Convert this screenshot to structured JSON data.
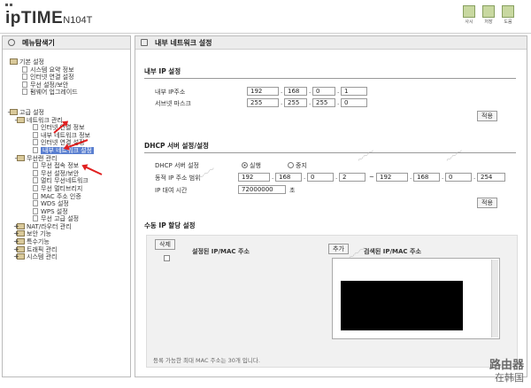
{
  "header": {
    "logo_main": "ipTIME",
    "logo_model": "N104T",
    "icons": [
      {
        "name": "help-icon",
        "label": "도움"
      },
      {
        "name": "save-icon",
        "label": "저장"
      },
      {
        "name": "info-icon",
        "label": "사시"
      }
    ]
  },
  "nav": {
    "title": "메뉴탐색기",
    "basic_setup": "기본 설정",
    "basic_items": [
      "시스템 요약 정보",
      "인터넷 연결 설정",
      "무선 설정/보안",
      "펌웨어 업그레이드"
    ],
    "advanced": "고급 설정",
    "network": "네트워크 관리",
    "network_items": [
      "인터넷 연결 정보",
      "내부 네트워크 정보",
      "인터넷 연결 설정",
      "내부 네트워크 설정"
    ],
    "wireless": "무선랜 관리",
    "wireless_items": [
      "무선 접속 정보",
      "무선 설정/보안",
      "멀티 무선네트워크",
      "무선 멀티브리지",
      "MAC 주소 인증",
      "WDS 설정",
      "WPS 설정",
      "무선 고급 설정"
    ],
    "other_groups": [
      "NAT/라우터 관리",
      "보안 기능",
      "특수기능",
      "트래픽 관리",
      "시스템 관리"
    ]
  },
  "content": {
    "panel_title": "내부 네트워크 설정",
    "ip_section": {
      "title": "내부 IP 설정",
      "ip_label": "내부 IP주소",
      "ip": [
        "192",
        "168",
        "0",
        "1"
      ],
      "mask_label": "서브넷 마스크",
      "mask": [
        "255",
        "255",
        "255",
        "0"
      ],
      "apply": "적용"
    },
    "dhcp_section": {
      "title": "DHCP 서버 설정/설정",
      "server_label": "DHCP 서버 설정",
      "opt_on": "실행",
      "opt_off": "중지",
      "range_label": "동적 IP 주소 범위",
      "range_start": [
        "192",
        "168",
        "0",
        "2"
      ],
      "range_end": [
        "192",
        "168",
        "0",
        "254"
      ],
      "tilde": "~",
      "lease_label": "IP 대여 시간",
      "lease_value": "72000000",
      "lease_unit": "초",
      "apply": "적용"
    },
    "manual_section": {
      "title": "수동 IP 할당 설정",
      "delete": "삭제",
      "set_header": "설정된 IP/MAC 주소",
      "add": "추가",
      "search_header": "검색된 IP/MAC 주소",
      "note": "등록 가능한 최대 MAC 주소는 30개 입니다."
    }
  },
  "watermark": {
    "brand": "路由器",
    "sub": "在韩国"
  }
}
